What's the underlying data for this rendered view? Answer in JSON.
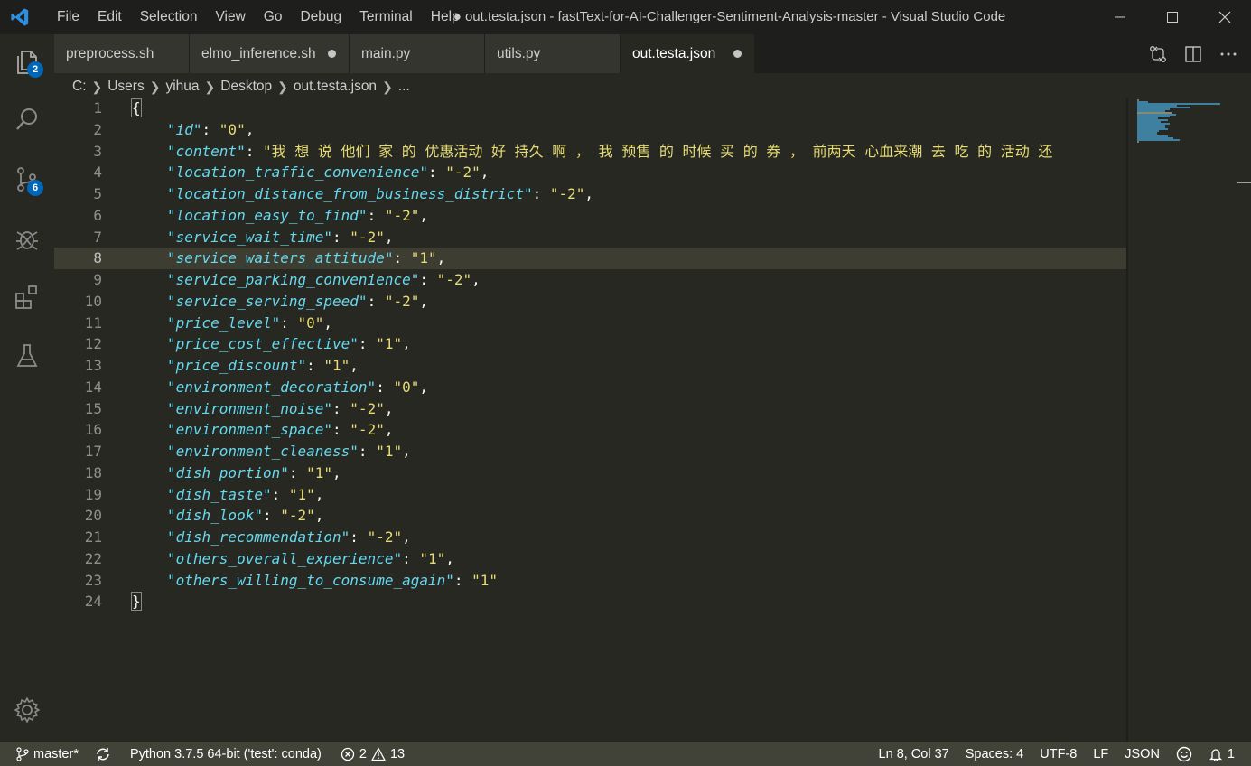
{
  "window": {
    "title": "● out.testa.json - fastText-for-AI-Challenger-Sentiment-Analysis-master - Visual Studio Code",
    "menu": [
      "File",
      "Edit",
      "Selection",
      "View",
      "Go",
      "Debug",
      "Terminal",
      "Help"
    ],
    "logo_icon": "vscode-logo-icon",
    "controls": [
      "minimize-icon",
      "maximize-icon",
      "close-icon"
    ]
  },
  "activity_bar": {
    "items": [
      {
        "icon": "explorer-icon",
        "badge": "2"
      },
      {
        "icon": "search-icon",
        "badge": ""
      },
      {
        "icon": "source-control-icon",
        "badge": "6"
      },
      {
        "icon": "debug-icon",
        "badge": ""
      },
      {
        "icon": "extensions-icon",
        "badge": ""
      },
      {
        "icon": "testing-flask-icon",
        "badge": ""
      }
    ],
    "manage_icon": "gear-icon"
  },
  "tabs": [
    {
      "label": "preprocess.sh",
      "dirty": false,
      "active": false
    },
    {
      "label": "elmo_inference.sh",
      "dirty": true,
      "active": false
    },
    {
      "label": "main.py",
      "dirty": false,
      "active": false
    },
    {
      "label": "utils.py",
      "dirty": false,
      "active": false
    },
    {
      "label": "out.testa.json",
      "dirty": true,
      "active": true
    }
  ],
  "editor_actions": [
    "open-changes-icon",
    "split-editor-icon",
    "more-actions-icon"
  ],
  "breadcrumb": [
    "C:",
    "Users",
    "yihua",
    "Desktop",
    "out.testa.json",
    "..."
  ],
  "editor": {
    "current_line": 8,
    "lines": [
      {
        "n": "1",
        "open": "{"
      },
      {
        "n": "2",
        "key": "\"id\"",
        "val": "\"0\"",
        "end": ","
      },
      {
        "n": "3",
        "key": "\"content\"",
        "val": "\"我 想 说 他们 家 的 优惠活动 好 持久 啊 ， 我 预售 的 时候 买 的 券 ， 前两天 心血来潮 去 吃 的 活动 还",
        "end": ""
      },
      {
        "n": "4",
        "key": "\"location_traffic_convenience\"",
        "val": "\"-2\"",
        "end": ","
      },
      {
        "n": "5",
        "key": "\"location_distance_from_business_district\"",
        "val": "\"-2\"",
        "end": ","
      },
      {
        "n": "6",
        "key": "\"location_easy_to_find\"",
        "val": "\"-2\"",
        "end": ","
      },
      {
        "n": "7",
        "key": "\"service_wait_time\"",
        "val": "\"-2\"",
        "end": ","
      },
      {
        "n": "8",
        "key": "\"service_waiters_attitude\"",
        "val": "\"1\"",
        "end": ","
      },
      {
        "n": "9",
        "key": "\"service_parking_convenience\"",
        "val": "\"-2\"",
        "end": ","
      },
      {
        "n": "10",
        "key": "\"service_serving_speed\"",
        "val": "\"-2\"",
        "end": ","
      },
      {
        "n": "11",
        "key": "\"price_level\"",
        "val": "\"0\"",
        "end": ","
      },
      {
        "n": "12",
        "key": "\"price_cost_effective\"",
        "val": "\"1\"",
        "end": ","
      },
      {
        "n": "13",
        "key": "\"price_discount\"",
        "val": "\"1\"",
        "end": ","
      },
      {
        "n": "14",
        "key": "\"environment_decoration\"",
        "val": "\"0\"",
        "end": ","
      },
      {
        "n": "15",
        "key": "\"environment_noise\"",
        "val": "\"-2\"",
        "end": ","
      },
      {
        "n": "16",
        "key": "\"environment_space\"",
        "val": "\"-2\"",
        "end": ","
      },
      {
        "n": "17",
        "key": "\"environment_cleaness\"",
        "val": "\"1\"",
        "end": ","
      },
      {
        "n": "18",
        "key": "\"dish_portion\"",
        "val": "\"1\"",
        "end": ","
      },
      {
        "n": "19",
        "key": "\"dish_taste\"",
        "val": "\"1\"",
        "end": ","
      },
      {
        "n": "20",
        "key": "\"dish_look\"",
        "val": "\"-2\"",
        "end": ","
      },
      {
        "n": "21",
        "key": "\"dish_recommendation\"",
        "val": "\"-2\"",
        "end": ","
      },
      {
        "n": "22",
        "key": "\"others_overall_experience\"",
        "val": "\"1\"",
        "end": ","
      },
      {
        "n": "23",
        "key": "\"others_willing_to_consume_again\"",
        "val": "\"1\"",
        "end": ""
      },
      {
        "n": "24",
        "open": "}"
      }
    ]
  },
  "status_bar": {
    "branch": "master*",
    "branch_icon": "git-branch-icon",
    "sync_icon": "sync-icon",
    "interpreter": "Python 3.7.5 64-bit ('test': conda)",
    "errors": "2",
    "warnings": "13",
    "cursor": "Ln 8, Col 37",
    "indent": "Spaces: 4",
    "encoding": "UTF-8",
    "eol": "LF",
    "language": "JSON",
    "feedback_icon": "smiley-icon",
    "notifications": "1"
  },
  "colors": {
    "key": "#66d9ef",
    "string": "#e6db74",
    "editor_bg": "#272822",
    "status_bg": "#414339",
    "badge": "#0066b8"
  }
}
